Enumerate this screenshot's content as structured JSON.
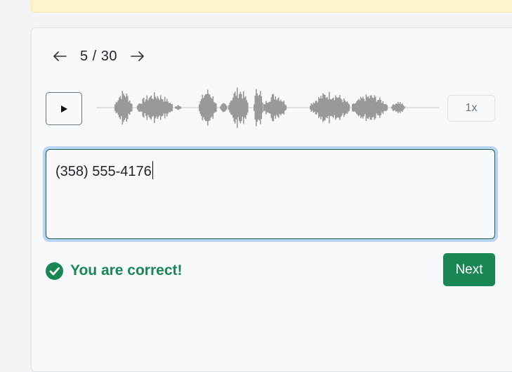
{
  "pager": {
    "prev_icon": "arrow-left-icon",
    "next_icon": "arrow-right-icon",
    "indicator": "5 / 30"
  },
  "player": {
    "play_icon": "play-icon",
    "speed_label": "1x"
  },
  "answer": {
    "value": "(358) 555-4176"
  },
  "feedback": {
    "icon": "check-circle-icon",
    "text": "You are correct!",
    "color": "#198754"
  },
  "actions": {
    "next_label": "Next",
    "next_color": "#198754"
  },
  "colors": {
    "banner": "#fff3cd",
    "waveform": "#999999",
    "focus_ring": "#b9d5f4"
  }
}
